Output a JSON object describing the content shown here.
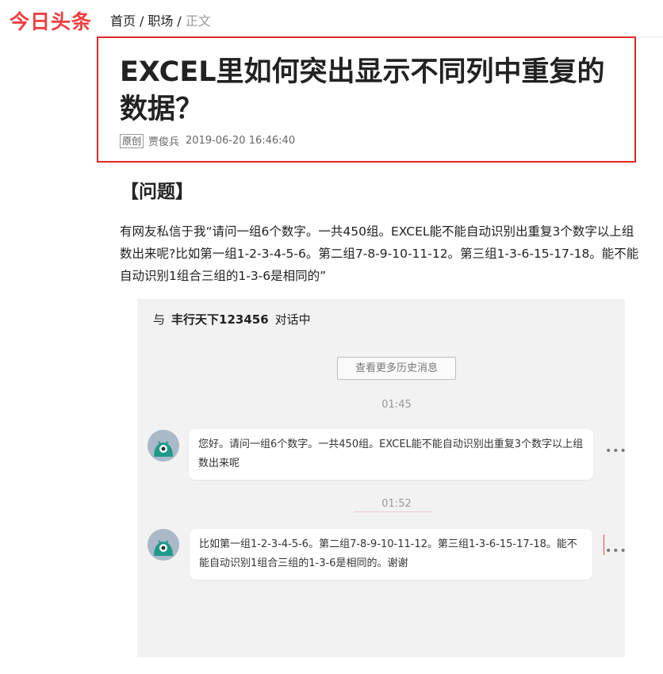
{
  "header": {
    "logo": "今日头条",
    "breadcrumb": [
      "首页",
      "职场",
      "正文"
    ]
  },
  "article": {
    "title": "EXCEL里如何突出显示不同列中重复的数据？",
    "badge": "原创",
    "author": "贾俊兵",
    "datetime": "2019-06-20 16:46:40",
    "section_heading": "【问题】",
    "paragraph": "有网友私信于我“请问一组6个数字。一共450组。EXCEL能不能自动识别出重复3个数字以上组数出来呢?比如第一组1-2-3-4-5-6。第二组7-8-9-10-11-12。第三组1-3-6-15-17-18。能不能自动识别1组合三组的1-3-6是相同的”"
  },
  "chat": {
    "header_prefix": "与",
    "contact": "丰行天下123456",
    "header_suffix": "对话中",
    "history_button": "查看更多历史消息",
    "messages": [
      {
        "time": "01:45",
        "text": "您好。请问一组6个数字。一共450组。EXCEL能不能自动识别出重复3个数字以上组数出来呢",
        "more": "•••"
      },
      {
        "time": "01:52",
        "text": "比如第一组1-2-3-4-5-6。第二组7-8-9-10-11-12。第三组1-3-6-15-17-18。能不能自动识别1组合三组的1-3-6是相同的。谢谢",
        "more": "•••"
      }
    ]
  },
  "colors": {
    "brand_red": "#ed4040",
    "highlight_box": "#e02828",
    "avatar_teal": "#1f9a8a",
    "avatar_bg": "#a9b9c8"
  },
  "icons": {
    "avatar": "bird-avatar-icon",
    "more": "more-dots-icon"
  }
}
